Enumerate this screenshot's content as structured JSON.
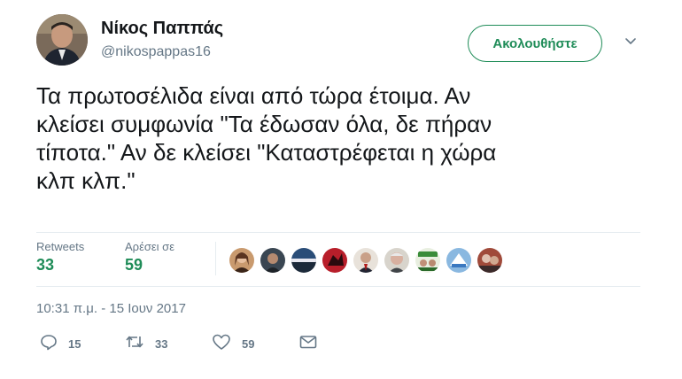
{
  "user": {
    "name": "Νίκος Παππάς",
    "handle": "@nikospappas16"
  },
  "follow_button": {
    "label": "Ακολουθήστε"
  },
  "tweet": {
    "text": "Τα πρωτοσέλιδα είναι από τώρα έτοιμα. Αν\nκλείσει συμφωνία \"Τα έδωσαν όλα, δε πήραν\nτίποτα.\" Αν δε κλείσει \"Καταστρέφεται η χώρα\nκλπ κλπ.\""
  },
  "stats": {
    "retweets_label": "Retweets",
    "retweets_value": "33",
    "likes_label": "Αρέσει σε",
    "likes_value": "59"
  },
  "timestamp": "10:31 π.μ. - 15 Ιουν 2017",
  "actions": {
    "reply_count": "15",
    "retweet_count": "33",
    "like_count": "59"
  },
  "colors": {
    "accent": "#1f8c58",
    "muted": "#657786",
    "text": "#14171a",
    "border": "#e6ecf0"
  },
  "icons": [
    "chevron-down-icon",
    "reply-icon",
    "retweet-icon",
    "heart-icon",
    "envelope-icon"
  ]
}
